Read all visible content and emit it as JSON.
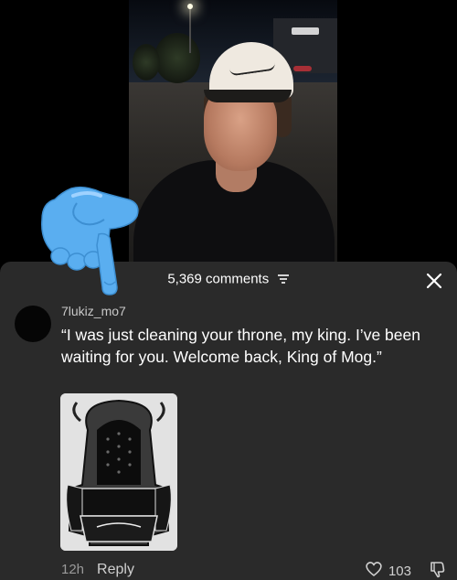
{
  "video": {
    "description_icon": "person-in-cap-video"
  },
  "overlay": {
    "emoji": "backhand-index-pointing-down-icon"
  },
  "comments": {
    "count_label": "5,369 comments",
    "filter_icon": "filter-icon",
    "close_icon": "close-icon",
    "items": [
      {
        "username": "7lukiz_mo7",
        "text": "“I was just cleaning your throne, my king. I’ve been waiting for you. Welcome back, King of Mog.”",
        "media_icon": "throne-image",
        "time": "12h",
        "reply_label": "Reply",
        "likes": "103"
      }
    ]
  },
  "colors": {
    "sheet_bg": "#2a2a2a",
    "hand_blue": "#5aaef0"
  }
}
